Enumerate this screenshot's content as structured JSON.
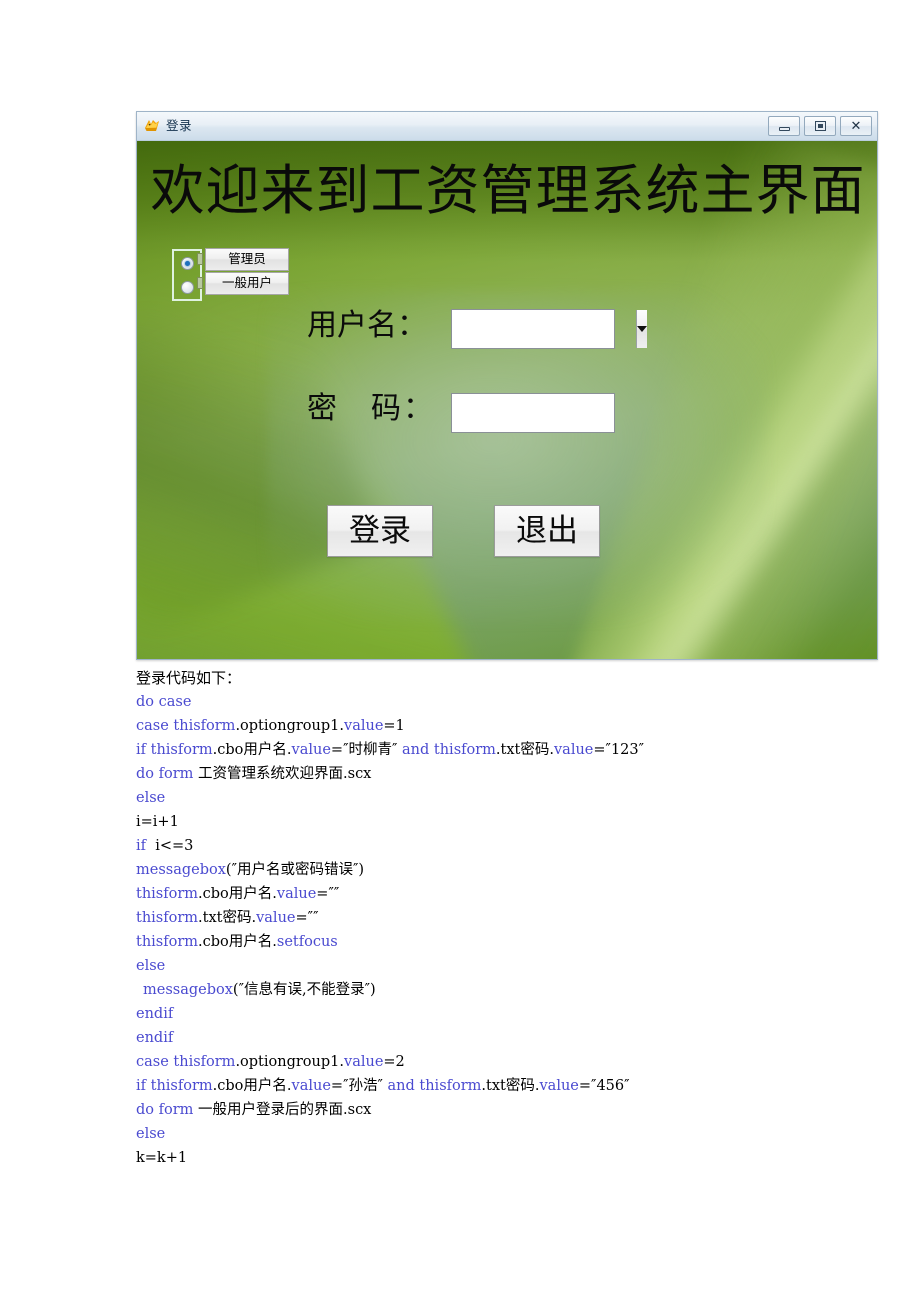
{
  "window": {
    "title": "登录",
    "icon": "foxpro-icon",
    "buttons": [
      {
        "name": "minimize",
        "label": "minimize-icon"
      },
      {
        "name": "restore",
        "label": "restore-icon"
      },
      {
        "name": "close",
        "label": "✕"
      }
    ]
  },
  "form": {
    "heading": "欢迎来到工资管理系统主界面",
    "option_group": {
      "selected_index": 0,
      "options": [
        {
          "label": "管理员",
          "checked": true
        },
        {
          "label": "一般用户",
          "checked": false
        }
      ]
    },
    "username": {
      "label": "用户名：",
      "value": "",
      "placeholder": ""
    },
    "password": {
      "label": "密　码：",
      "value": "",
      "placeholder": ""
    },
    "login_button": "登录",
    "exit_button": "退出"
  },
  "code": {
    "caption": "登录代码如下：",
    "lines": [
      {
        "indent": false,
        "parts": [
          {
            "t": "do case",
            "kw": true
          }
        ]
      },
      {
        "indent": false,
        "parts": [
          {
            "t": "case ",
            "kw": true
          },
          {
            "t": "thisform",
            "kw": true
          },
          {
            "t": ".optiongroup1.",
            "kw": false
          },
          {
            "t": "value",
            "kw": true
          },
          {
            "t": "=1",
            "kw": false
          }
        ]
      },
      {
        "indent": false,
        "parts": [
          {
            "t": "if ",
            "kw": true
          },
          {
            "t": "thisform",
            "kw": true
          },
          {
            "t": ".cbo用户名.",
            "kw": false
          },
          {
            "t": "value",
            "kw": true
          },
          {
            "t": "=″时柳青″ ",
            "kw": false
          },
          {
            "t": "and ",
            "kw": true
          },
          {
            "t": "thisform",
            "kw": true
          },
          {
            "t": ".txt密码.",
            "kw": false
          },
          {
            "t": "value",
            "kw": true
          },
          {
            "t": "=″123″",
            "kw": false
          }
        ]
      },
      {
        "indent": false,
        "parts": [
          {
            "t": "do form ",
            "kw": true
          },
          {
            "t": "工资管理系统欢迎界面.scx",
            "kw": false
          }
        ]
      },
      {
        "indent": false,
        "parts": [
          {
            "t": "else",
            "kw": true
          }
        ]
      },
      {
        "indent": false,
        "parts": [
          {
            "t": "i=i+1",
            "kw": false
          }
        ]
      },
      {
        "indent": false,
        "parts": [
          {
            "t": "if ",
            "kw": true
          },
          {
            "t": " i<=3",
            "kw": false
          }
        ]
      },
      {
        "indent": false,
        "parts": [
          {
            "t": "messagebox",
            "kw": true
          },
          {
            "t": "(″用户名或密码错误″)",
            "kw": false
          }
        ]
      },
      {
        "indent": false,
        "parts": [
          {
            "t": "thisform",
            "kw": true
          },
          {
            "t": ".cbo用户名.",
            "kw": false
          },
          {
            "t": "value",
            "kw": true
          },
          {
            "t": "=″″",
            "kw": false
          }
        ]
      },
      {
        "indent": false,
        "parts": [
          {
            "t": "thisform",
            "kw": true
          },
          {
            "t": ".txt密码.",
            "kw": false
          },
          {
            "t": "value",
            "kw": true
          },
          {
            "t": "=″″",
            "kw": false
          }
        ]
      },
      {
        "indent": false,
        "parts": [
          {
            "t": "thisform",
            "kw": true
          },
          {
            "t": ".cbo用户名.",
            "kw": false
          },
          {
            "t": "setfocus",
            "kw": true
          }
        ]
      },
      {
        "indent": false,
        "parts": [
          {
            "t": "else",
            "kw": true
          }
        ]
      },
      {
        "indent": true,
        "parts": [
          {
            "t": "messagebox",
            "kw": true
          },
          {
            "t": "(″信息有误,不能登录″)",
            "kw": false
          }
        ]
      },
      {
        "indent": false,
        "parts": [
          {
            "t": "endif",
            "kw": true
          }
        ]
      },
      {
        "indent": false,
        "parts": [
          {
            "t": "endif",
            "kw": true
          }
        ]
      },
      {
        "indent": false,
        "parts": [
          {
            "t": "case ",
            "kw": true
          },
          {
            "t": "thisform",
            "kw": true
          },
          {
            "t": ".optiongroup1.",
            "kw": false
          },
          {
            "t": "value",
            "kw": true
          },
          {
            "t": "=2",
            "kw": false
          }
        ]
      },
      {
        "indent": false,
        "parts": [
          {
            "t": "if ",
            "kw": true
          },
          {
            "t": "thisform",
            "kw": true
          },
          {
            "t": ".cbo用户名.",
            "kw": false
          },
          {
            "t": "value",
            "kw": true
          },
          {
            "t": "=″孙浩″ ",
            "kw": false
          },
          {
            "t": "and ",
            "kw": true
          },
          {
            "t": "thisform",
            "kw": true
          },
          {
            "t": ".txt密码.",
            "kw": false
          },
          {
            "t": "value",
            "kw": true
          },
          {
            "t": "=″456″",
            "kw": false
          }
        ]
      },
      {
        "indent": false,
        "parts": [
          {
            "t": "do form ",
            "kw": true
          },
          {
            "t": "一般用户登录后的界面.scx",
            "kw": false
          }
        ]
      },
      {
        "indent": false,
        "parts": [
          {
            "t": "else",
            "kw": true
          }
        ]
      },
      {
        "indent": false,
        "parts": [
          {
            "t": "k=k+1",
            "kw": false
          }
        ]
      }
    ]
  },
  "colors": {
    "keyword": "#4a4ad0",
    "text": "#000000",
    "titlebar_text": "#14324e",
    "leaf_green": "#6d9a22"
  }
}
